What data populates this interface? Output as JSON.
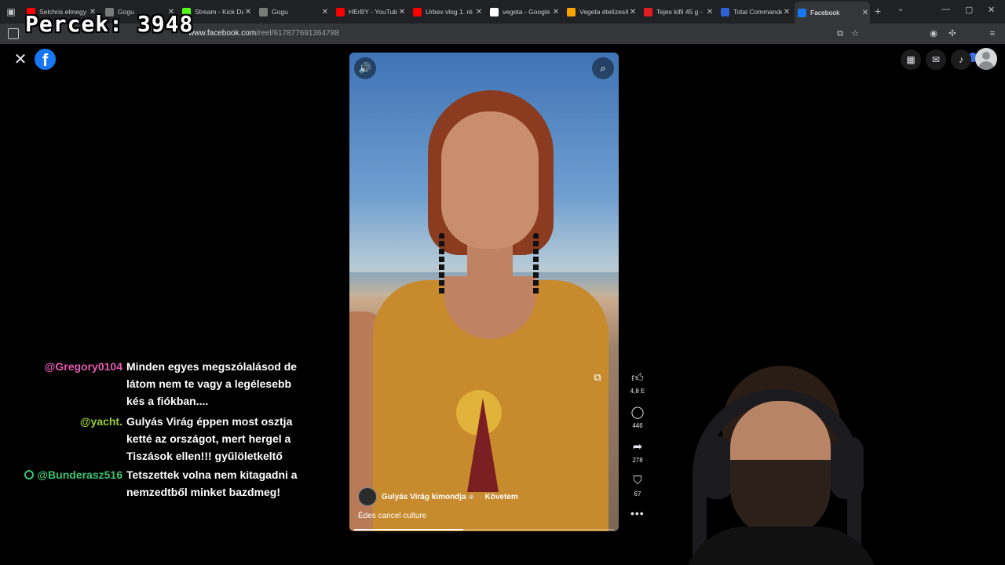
{
  "overlay": {
    "counter_label": "Percek:",
    "counter_value": "3948"
  },
  "browser": {
    "tabs": [
      {
        "title": "Selchris elmegy",
        "favicon_color": "#ff0000"
      },
      {
        "title": "Gogu",
        "favicon_color": "#7a7a7a"
      },
      {
        "title": "Stream - Kick Da",
        "favicon_color": "#53fc18"
      },
      {
        "title": "Gogu",
        "favicon_color": "#7a7a7a"
      },
      {
        "title": "HErBY - YouTube",
        "favicon_color": "#ff0000"
      },
      {
        "title": "Urbex vlog 1. ré",
        "favicon_color": "#ff0000"
      },
      {
        "title": "vegeta - Google",
        "favicon_color": "#ffffff"
      },
      {
        "title": "Vegeta ételízesít",
        "favicon_color": "#f6a400"
      },
      {
        "title": "Tejes kifli 45 g -",
        "favicon_color": "#e31b23"
      },
      {
        "title": "Total Commande",
        "favicon_color": "#2f5fd0"
      },
      {
        "title": "Facebook",
        "favicon_color": "#1877f2",
        "active": true
      }
    ],
    "url": {
      "prefix": "",
      "host": "www.facebook.com",
      "path": "/reel/917877691364788"
    }
  },
  "facebook": {
    "logo_letter": "f",
    "top_icons": [
      "apps-grid-icon",
      "messenger-icon",
      "notifications-bell-icon"
    ]
  },
  "reel": {
    "author": "Gulyás Virág kimondja",
    "follow_label": "Követem",
    "separator": "·",
    "caption": "Édes cancel culture",
    "progress_fraction": 0.42,
    "actions": [
      {
        "name": "like",
        "icon": "thumbs-up-icon",
        "count": "4,8 E"
      },
      {
        "name": "comment",
        "icon": "comment-icon",
        "count": "446"
      },
      {
        "name": "share",
        "icon": "share-icon",
        "count": "278"
      },
      {
        "name": "save",
        "icon": "bookmark-icon",
        "count": "67"
      }
    ]
  },
  "chat": [
    {
      "user": "@Gregory0104",
      "user_color": "#e85ab0",
      "text": "Minden egyes megszólalásod de látom nem te vagy a legélesebb kés a fiókban....",
      "has_icon": false
    },
    {
      "user": "@yacht.",
      "user_color": "#9acd32",
      "text": "Gulyás Virág éppen most osztja ketté az országot, mert hergel a Tiszások ellen!!! gyűlöletkeltő",
      "has_icon": false
    },
    {
      "user": "@Bunderasz516",
      "user_color": "#3cc472",
      "text": "Tetszettek volna nem kitagadni a nemzedtből minket bazdmeg!",
      "has_icon": true
    }
  ]
}
